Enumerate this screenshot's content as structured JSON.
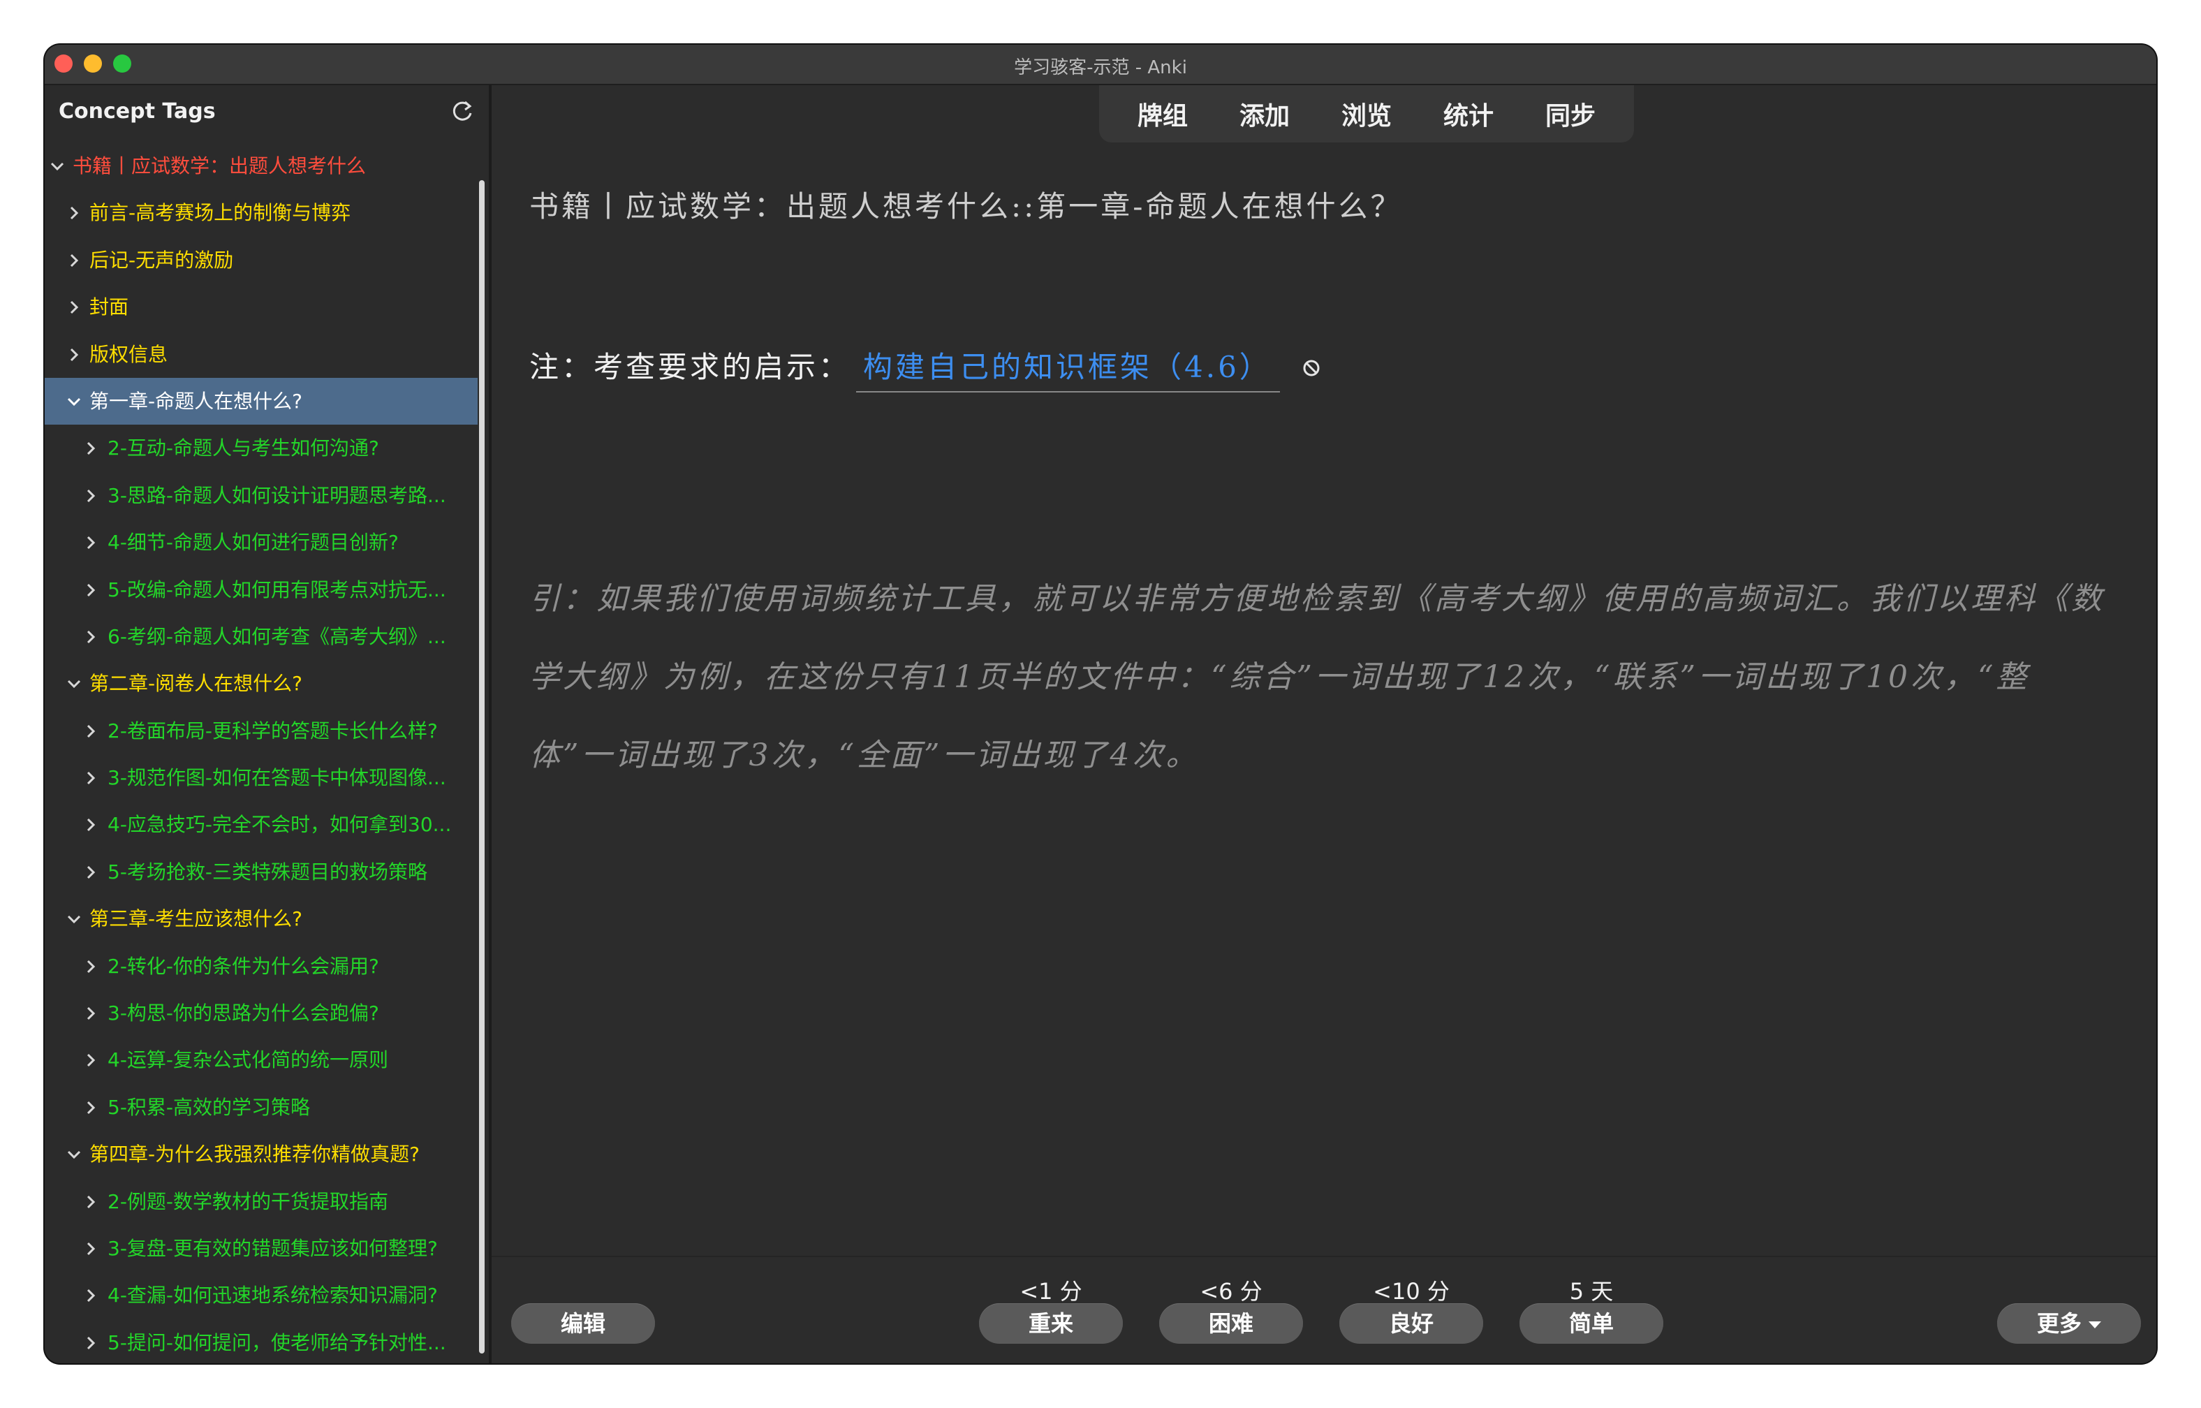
{
  "window": {
    "title": "学习骇客-示范 - Anki"
  },
  "sidebar": {
    "title": "Concept Tags",
    "items": [
      {
        "label": "书籍丨应试数学：出题人想考什么",
        "level": 0,
        "expanded": true,
        "color": "red"
      },
      {
        "label": "前言-高考赛场上的制衡与博弈",
        "level": 1,
        "expanded": false,
        "color": "yellow"
      },
      {
        "label": "后记-无声的激励",
        "level": 1,
        "expanded": false,
        "color": "yellow"
      },
      {
        "label": "封面",
        "level": 1,
        "expanded": false,
        "color": "yellow"
      },
      {
        "label": "版权信息",
        "level": 1,
        "expanded": false,
        "color": "yellow"
      },
      {
        "label": "第一章-命题人在想什么?",
        "level": 1,
        "expanded": true,
        "color": "white",
        "selected": true
      },
      {
        "label": "2-互动-命题人与考生如何沟通?",
        "level": 2,
        "expanded": false,
        "color": "green"
      },
      {
        "label": "3-思路-命题人如何设计证明题思考路...",
        "level": 2,
        "expanded": false,
        "color": "green"
      },
      {
        "label": "4-细节-命题人如何进行题目创新?",
        "level": 2,
        "expanded": false,
        "color": "green"
      },
      {
        "label": "5-改编-命题人如何用有限考点对抗无...",
        "level": 2,
        "expanded": false,
        "color": "green"
      },
      {
        "label": "6-考纲-命题人如何考查《高考大纲》...",
        "level": 2,
        "expanded": false,
        "color": "green"
      },
      {
        "label": "第二章-阅卷人在想什么?",
        "level": 1,
        "expanded": true,
        "color": "yellow"
      },
      {
        "label": "2-卷面布局-更科学的答题卡长什么样?",
        "level": 2,
        "expanded": false,
        "color": "green"
      },
      {
        "label": "3-规范作图-如何在答题卡中体现图像...",
        "level": 2,
        "expanded": false,
        "color": "green"
      },
      {
        "label": "4-应急技巧-完全不会时，如何拿到30...",
        "level": 2,
        "expanded": false,
        "color": "green"
      },
      {
        "label": "5-考场抢救-三类特殊题目的救场策略",
        "level": 2,
        "expanded": false,
        "color": "green"
      },
      {
        "label": "第三章-考生应该想什么?",
        "level": 1,
        "expanded": true,
        "color": "yellow"
      },
      {
        "label": "2-转化-你的条件为什么会漏用?",
        "level": 2,
        "expanded": false,
        "color": "green"
      },
      {
        "label": "3-构思-你的思路为什么会跑偏?",
        "level": 2,
        "expanded": false,
        "color": "green"
      },
      {
        "label": "4-运算-复杂公式化简的统一原则",
        "level": 2,
        "expanded": false,
        "color": "green"
      },
      {
        "label": "5-积累-高效的学习策略",
        "level": 2,
        "expanded": false,
        "color": "green"
      },
      {
        "label": "第四章-为什么我强烈推荐你精做真题?",
        "level": 1,
        "expanded": true,
        "color": "yellow"
      },
      {
        "label": "2-例题-数学教材的干货提取指南",
        "level": 2,
        "expanded": false,
        "color": "green"
      },
      {
        "label": "3-复盘-更有效的错题集应该如何整理?",
        "level": 2,
        "expanded": false,
        "color": "green"
      },
      {
        "label": "4-查漏-如何迅速地系统检索知识漏洞?",
        "level": 2,
        "expanded": false,
        "color": "green"
      },
      {
        "label": "5-提问-如何提问，使老师给予针对性...",
        "level": 2,
        "expanded": false,
        "color": "green"
      }
    ]
  },
  "toolbar": {
    "decks": "牌组",
    "add": "添加",
    "browse": "浏览",
    "stats": "统计",
    "sync": "同步"
  },
  "card": {
    "title": "书籍丨应试数学：出题人想考什么::第一章-命题人在想什么？",
    "note_prefix": "注：考查要求的启示：",
    "note_link": "构建自己的知识框架（4.6）",
    "quote": "引：如果我们使用词频统计工具，就可以非常方便地检索到《高考大纲》使用的高频词汇。我们以理科《数学大纲》为例，在这份只有11页半的文件中：“综合”一词出现了12次，“联系”一词出现了10次，“整体”一词出现了3次，“全面”一词出现了4次。"
  },
  "bottom": {
    "edit": "编辑",
    "more": "更多",
    "answers": [
      {
        "time": "<1 分",
        "label": "重来"
      },
      {
        "time": "<6 分",
        "label": "困难"
      },
      {
        "time": "<10 分",
        "label": "良好"
      },
      {
        "time": "5 天",
        "label": "简单"
      }
    ]
  },
  "colors": {
    "red": "#ff4d3d",
    "yellow": "#ffde00",
    "green": "#23d629",
    "link": "#3d8ef0",
    "selected": "#4d6b8c"
  }
}
